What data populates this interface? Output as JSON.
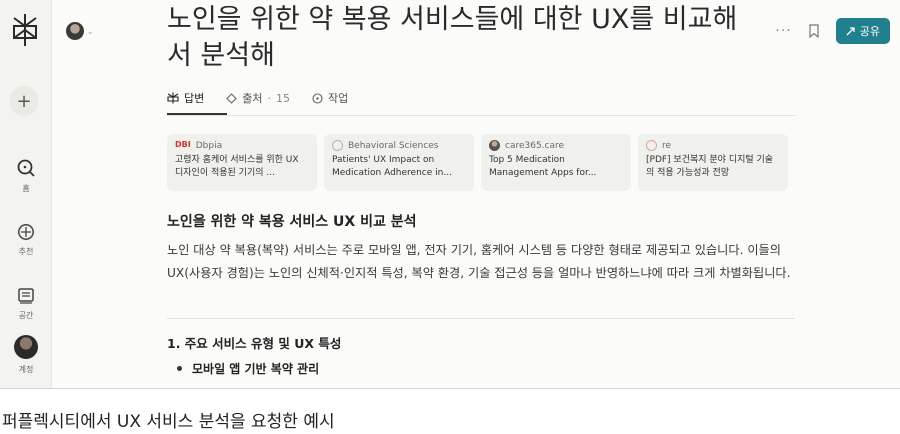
{
  "app": {
    "share_label": "공유",
    "more_icon": "ellipsis-icon",
    "bookmark_icon": "bookmark-icon",
    "accent_color": "#20808d"
  },
  "rail": {
    "new_thread_icon": "plus-icon",
    "items": [
      {
        "label": "홈",
        "icon": "home-search-icon"
      },
      {
        "label": "추천",
        "icon": "discover-icon"
      },
      {
        "label": "공간",
        "icon": "spaces-icon"
      },
      {
        "label": "계정",
        "icon": "avatar"
      }
    ]
  },
  "thread": {
    "title": "노인을 위한 약 복용 서비스들에 대한 UX를 비교해 서 분석해"
  },
  "tabs": [
    {
      "label": "답변",
      "icon": "perplexity-icon",
      "active": true
    },
    {
      "label": "출처",
      "count": "15",
      "icon": "sources-icon",
      "active": false
    },
    {
      "label": "작업",
      "icon": "tasks-icon",
      "active": false
    }
  ],
  "sources": [
    {
      "site": "Dbpia",
      "title": "고령자 홈케어 서비스를 위한 UX 디자인이 적용된 기기의 ..."
    },
    {
      "site": "Behavioral Sciences",
      "title": "Patients' UX Impact on Medication Adherence in..."
    },
    {
      "site": "care365.care",
      "title": "Top 5 Medication Management Apps for..."
    },
    {
      "site": "re",
      "title": "[PDF] 보건복지 분야 디지털 기술의 적용 가능성과 전망"
    }
  ],
  "answer": {
    "heading": "노인을 위한 약 복용 서비스 UX 비교 분석",
    "paragraph": "노인 대상 약 복용(복약) 서비스는 주로 모바일 앱, 전자 기기, 홈케어 시스템 등 다양한 형태로 제공되고 있습니다. 이들의 UX(사용자 경험)는 노인의 신체적·인지적 특성, 복약 환경, 기술 접근성 등을 얼마나 반영하느냐에 따라 크게 차별화됩니다.",
    "section_title": "1. 주요 서비스 유형 및 UX 특성",
    "bullet_1": "모바일 앱 기반 복약 관리"
  },
  "caption": "퍼플렉시티에서 UX 서비스 분석을 요청한 예시"
}
